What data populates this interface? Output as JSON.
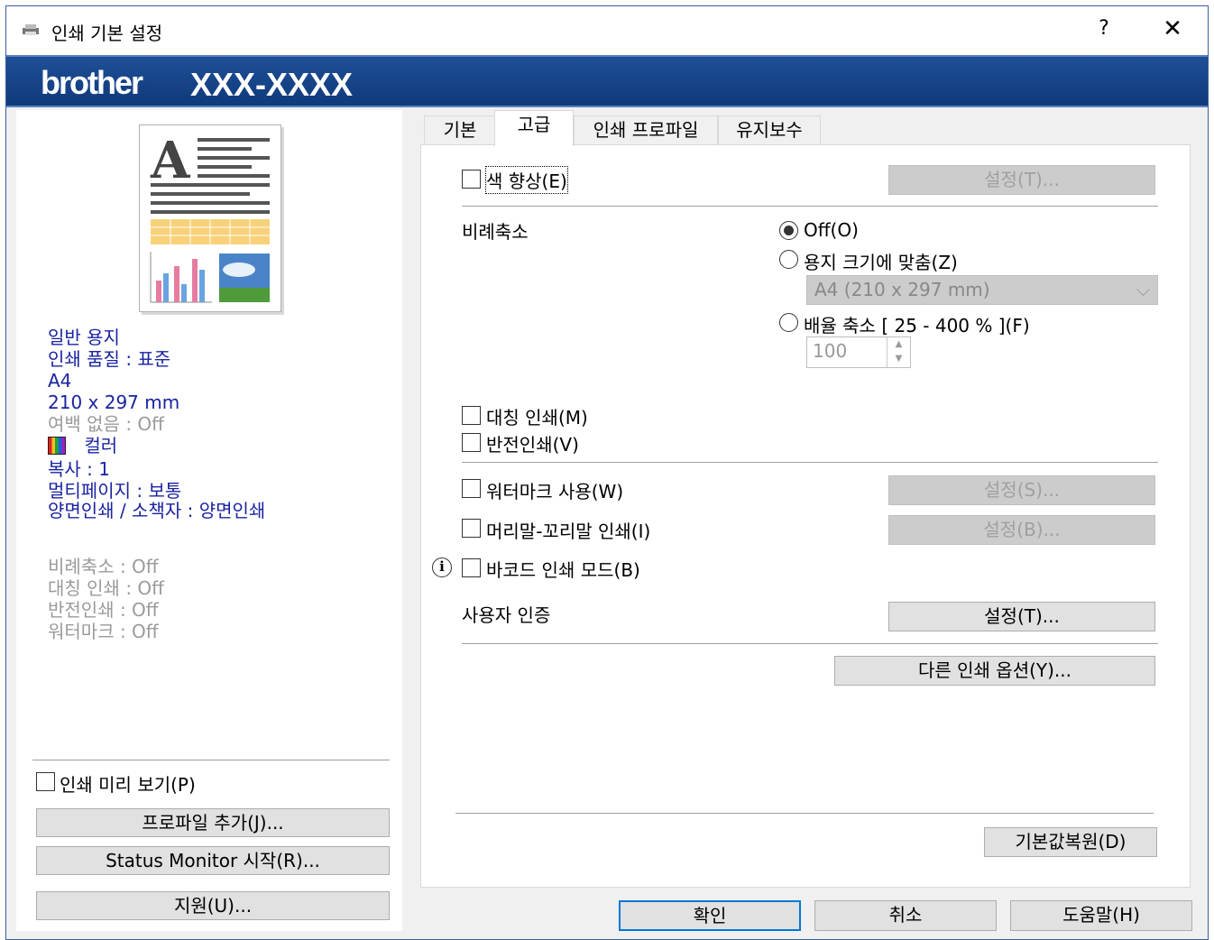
{
  "window": {
    "title": "인쇄 기본 설정",
    "help": "?",
    "close": "✕",
    "brand": "brother",
    "model": "XXX-XXXX"
  },
  "summary": {
    "lines_active": [
      "일반 용지",
      "인쇄 품질 : 표준",
      "A4",
      "210 x 297 mm"
    ],
    "borderless": "여백 없음 : Off",
    "color": "컬러",
    "lines_active2": [
      "복사 : 1",
      "멀티페이지 : 보통",
      "양면인쇄 / 소책자 : 양면인쇄"
    ],
    "lines_inactive": [
      "비례축소 : Off",
      "대칭 인쇄 : Off",
      "반전인쇄 : Off",
      "워터마크 : Off"
    ]
  },
  "left_controls": {
    "print_preview": "인쇄 미리 보기(P)",
    "add_profile": "프로파일 추가(J)...",
    "status_monitor": "Status Monitor 시작(R)...",
    "support": "지원(U)..."
  },
  "tabs": [
    "기본",
    "고급",
    "인쇄 프로파일",
    "유지보수"
  ],
  "advanced": {
    "color_enhance": "색 향상(E)",
    "color_enhance_settings": "설정(T)...",
    "scaling_label": "비례축소",
    "scaling_off": "Off(O)",
    "fit_to_paper": "용지 크기에 맞춤(Z)",
    "paper_size": "A4 (210 x 297 mm)",
    "free_scale": "배율 축소 [ 25 - 400 % ](F)",
    "free_scale_value": "100",
    "mirror_print": "대칭 인쇄(M)",
    "reverse_print": "반전인쇄(V)",
    "watermark": "워터마크 사용(W)",
    "watermark_settings": "설정(S)...",
    "header_footer": "머리말-꼬리말 인쇄(I)",
    "header_footer_settings": "설정(B)...",
    "barcode_mode": "바코드 인쇄 모드(B)",
    "user_auth": "사용자 인증",
    "user_auth_settings": "설정(T)...",
    "other_options": "다른 인쇄 옵션(Y)...",
    "restore_defaults": "기본값복원(D)"
  },
  "footer": {
    "ok": "확인",
    "cancel": "취소",
    "help": "도움말(H)"
  },
  "colors": {
    "banner": "#1a4a8f",
    "summary_text": "#1a23a0",
    "disabled_text": "#a0a0a0"
  }
}
